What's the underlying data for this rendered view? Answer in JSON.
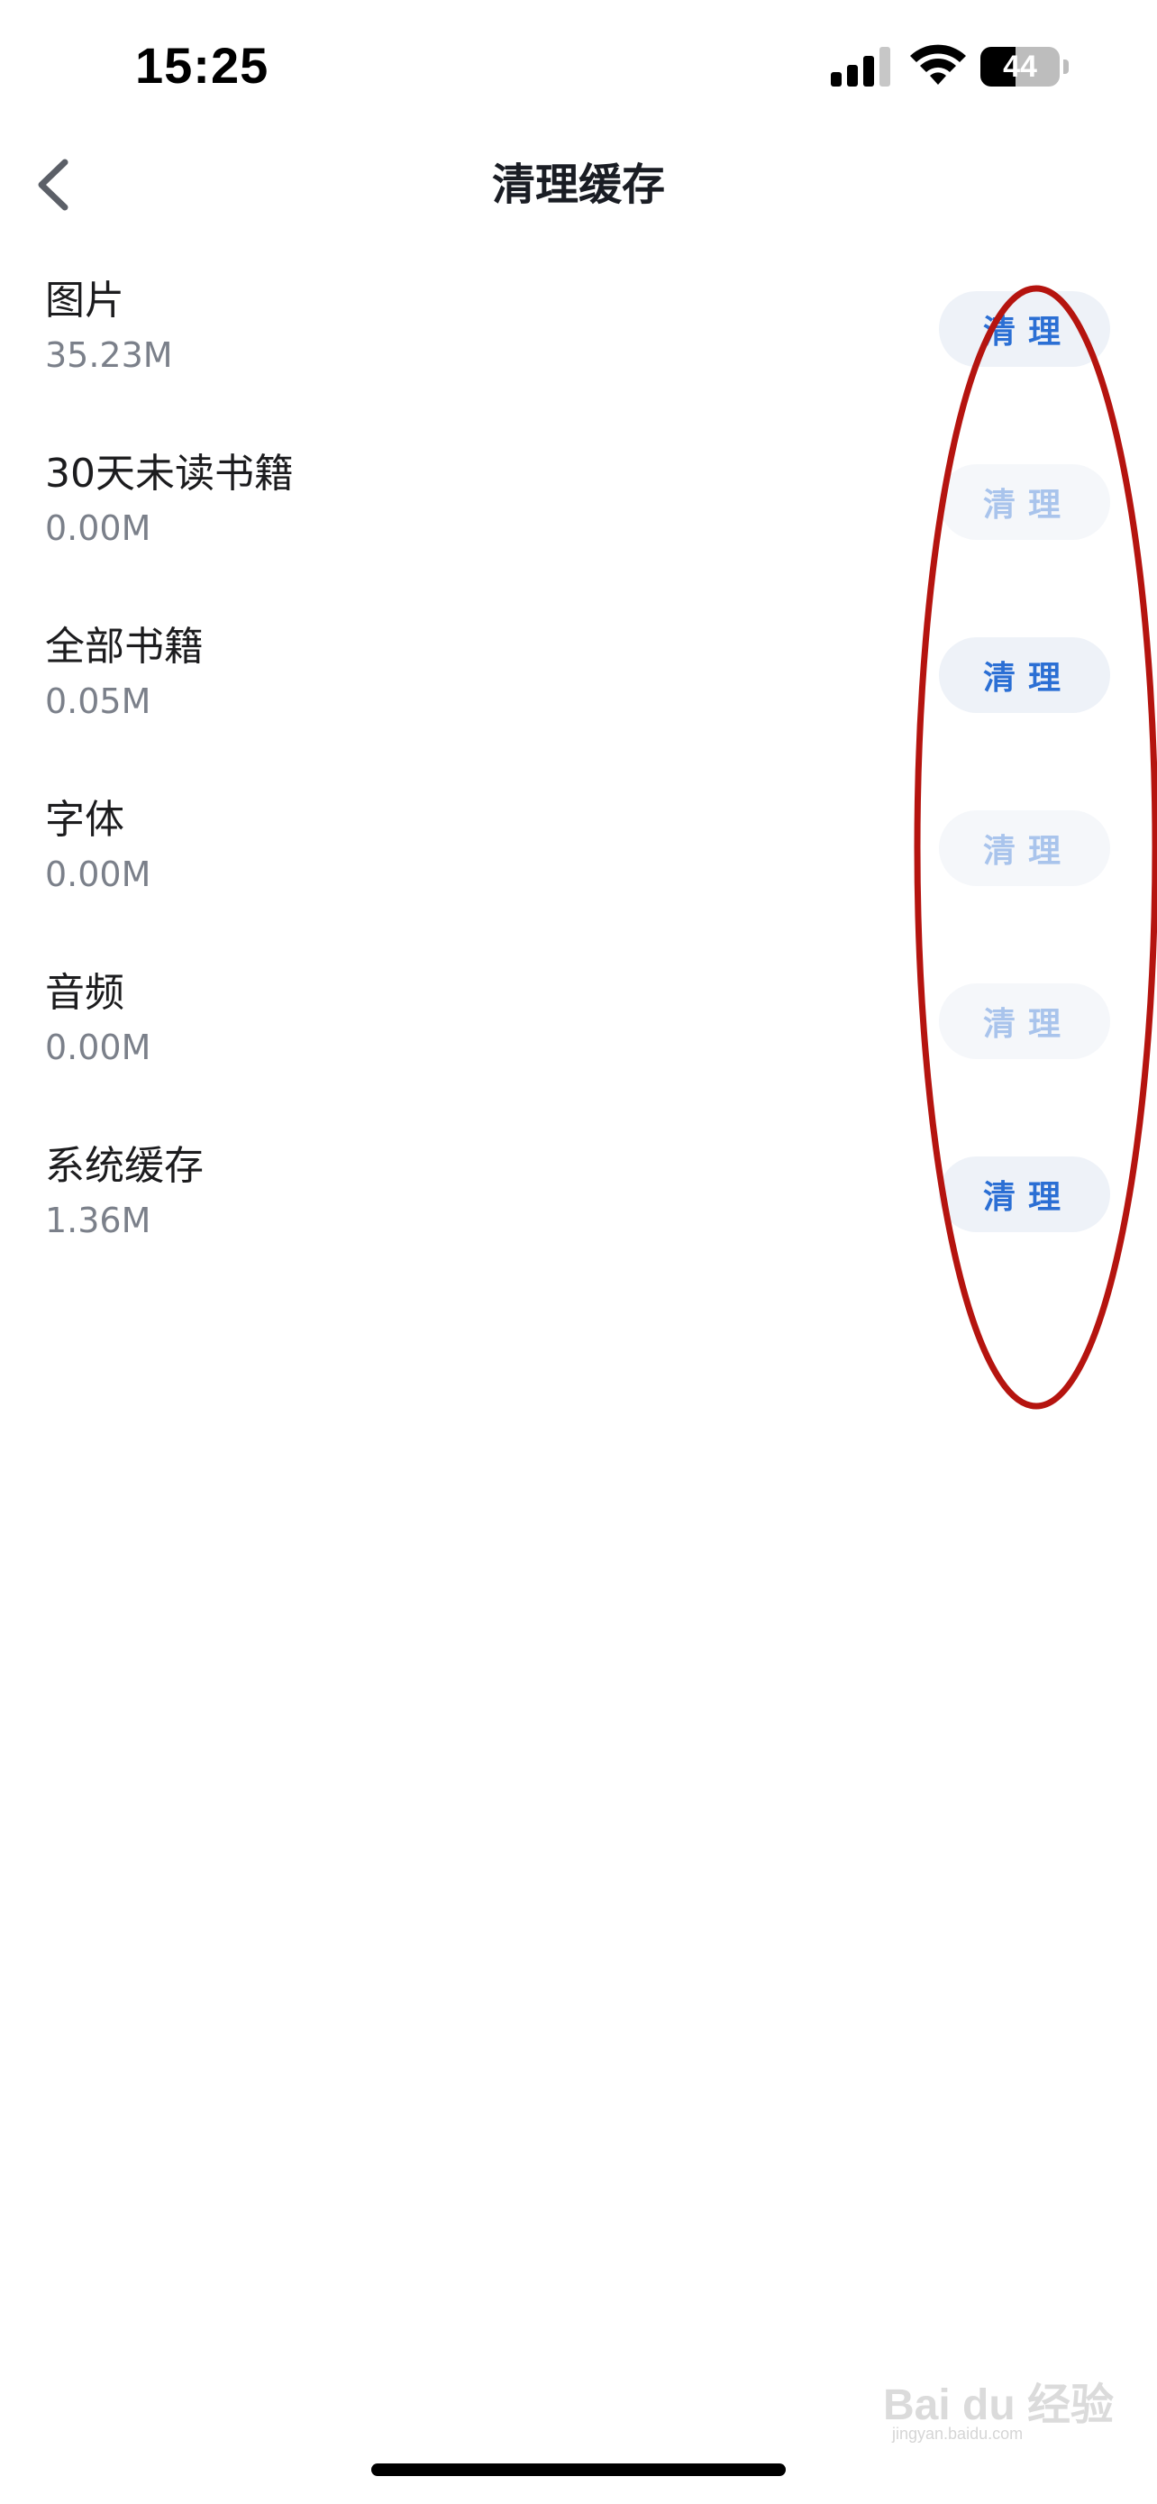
{
  "status_bar": {
    "time": "15:25",
    "battery_level": "44",
    "battery_percent": 44,
    "signal_bars_active": 3,
    "signal_bars_total": 4
  },
  "nav": {
    "title": "清理缓存",
    "back_icon": "chevron-left-icon"
  },
  "items": [
    {
      "name": "图片",
      "size": "35.23M",
      "button_label": "清理",
      "enabled": true
    },
    {
      "name": "30天未读书籍",
      "size": "0.00M",
      "button_label": "清理",
      "enabled": false
    },
    {
      "name": "全部书籍",
      "size": "0.05M",
      "button_label": "清理",
      "enabled": true
    },
    {
      "name": "字体",
      "size": "0.00M",
      "button_label": "清理",
      "enabled": false
    },
    {
      "name": "音频",
      "size": "0.00M",
      "button_label": "清理",
      "enabled": false
    },
    {
      "name": "系统缓存",
      "size": "1.36M",
      "button_label": "清理",
      "enabled": true
    }
  ],
  "watermark": {
    "main": "Bai du 经验",
    "sub": "jingyan.baidu.com"
  },
  "colors": {
    "accent": "#2b6fd4",
    "accent_disabled": "#a9c4ec",
    "button_bg": "#eef2f8",
    "annotation": "#b5140f",
    "secondary_text": "#7b808a"
  }
}
